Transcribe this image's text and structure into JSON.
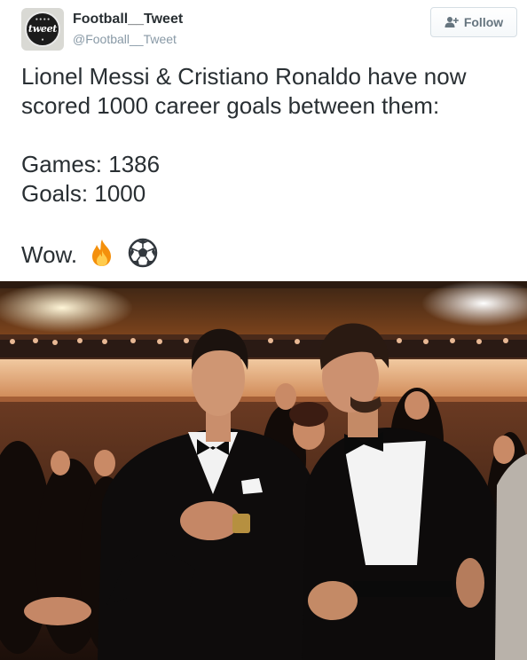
{
  "tweet": {
    "display_name": "Football__Tweet",
    "handle": "@Football__Tweet",
    "avatar_mark": "tweet",
    "follow_label": "Follow",
    "text_lines": [
      "Lionel Messi & Cristiano Ronaldo have now",
      "scored 1000 career goals between them:",
      "",
      "Games: 1386",
      "Goals: 1000",
      "",
      "Wow."
    ],
    "emojis": [
      "fire-icon",
      "soccer-ball-icon"
    ]
  },
  "colors": {
    "name": "#292f33",
    "handle": "#8899a6",
    "follow_text": "#66757f",
    "follow_border": "#d5dee4"
  }
}
